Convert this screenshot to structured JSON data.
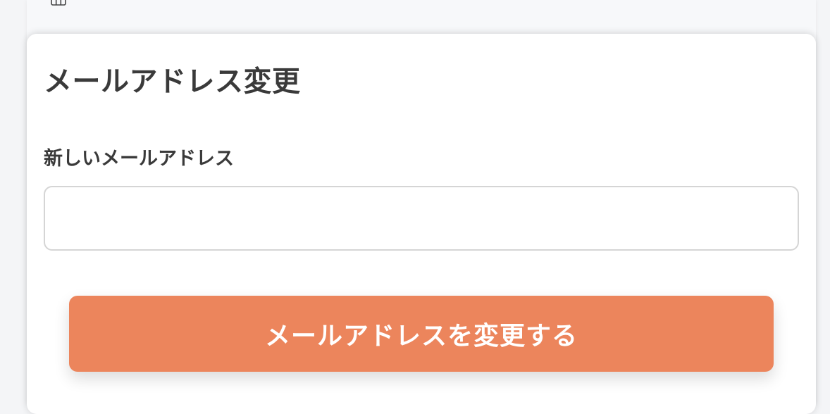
{
  "header": {
    "icon": "grid-icon"
  },
  "card": {
    "title": "メールアドレス変更",
    "field_label": "新しいメールアドレス",
    "email_value": "",
    "submit_label": "メールアドレスを変更する"
  },
  "colors": {
    "accent": "#ec855c",
    "text": "#3a3a3a",
    "input_border": "#d5d5d5"
  }
}
